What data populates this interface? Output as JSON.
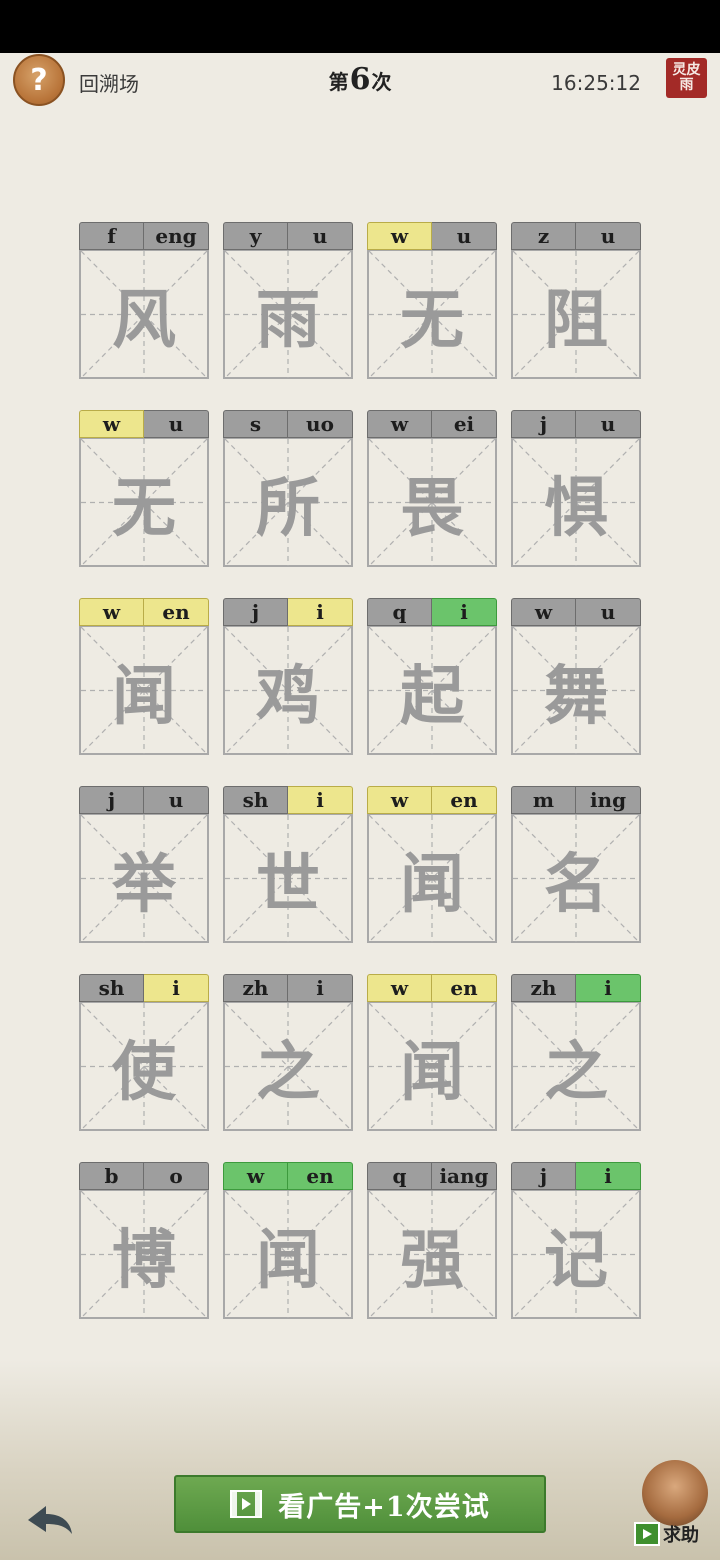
{
  "header": {
    "help_glyph": "?",
    "back_label": "回溯场",
    "attempt_prefix": "第",
    "attempt_number": "6",
    "attempt_suffix": "次",
    "clock": "16:25:12",
    "seal_text": "灵皮雨"
  },
  "colors": {
    "gray": "#9e9e9e",
    "yellow": "#ede68d",
    "green": "#6bc46b"
  },
  "rows": [
    [
      {
        "initial": "f",
        "final": "eng",
        "initial_state": "gray",
        "final_state": "gray",
        "char": "风"
      },
      {
        "initial": "y",
        "final": "u",
        "initial_state": "gray",
        "final_state": "gray",
        "char": "雨"
      },
      {
        "initial": "w",
        "final": "u",
        "initial_state": "yellow",
        "final_state": "gray",
        "char": "无"
      },
      {
        "initial": "z",
        "final": "u",
        "initial_state": "gray",
        "final_state": "gray",
        "char": "阻"
      }
    ],
    [
      {
        "initial": "w",
        "final": "u",
        "initial_state": "yellow",
        "final_state": "gray",
        "char": "无"
      },
      {
        "initial": "s",
        "final": "uo",
        "initial_state": "gray",
        "final_state": "gray",
        "char": "所"
      },
      {
        "initial": "w",
        "final": "ei",
        "initial_state": "gray",
        "final_state": "gray",
        "char": "畏"
      },
      {
        "initial": "j",
        "final": "u",
        "initial_state": "gray",
        "final_state": "gray",
        "char": "惧"
      }
    ],
    [
      {
        "initial": "w",
        "final": "en",
        "initial_state": "yellow",
        "final_state": "yellow",
        "char": "闻"
      },
      {
        "initial": "j",
        "final": "i",
        "initial_state": "gray",
        "final_state": "yellow",
        "char": "鸡"
      },
      {
        "initial": "q",
        "final": "i",
        "initial_state": "gray",
        "final_state": "green",
        "char": "起"
      },
      {
        "initial": "w",
        "final": "u",
        "initial_state": "gray",
        "final_state": "gray",
        "char": "舞"
      }
    ],
    [
      {
        "initial": "j",
        "final": "u",
        "initial_state": "gray",
        "final_state": "gray",
        "char": "举"
      },
      {
        "initial": "sh",
        "final": "i",
        "initial_state": "gray",
        "final_state": "yellow",
        "char": "世"
      },
      {
        "initial": "w",
        "final": "en",
        "initial_state": "yellow",
        "final_state": "yellow",
        "char": "闻"
      },
      {
        "initial": "m",
        "final": "ing",
        "initial_state": "gray",
        "final_state": "gray",
        "char": "名"
      }
    ],
    [
      {
        "initial": "sh",
        "final": "i",
        "initial_state": "gray",
        "final_state": "yellow",
        "char": "使"
      },
      {
        "initial": "zh",
        "final": "i",
        "initial_state": "gray",
        "final_state": "gray",
        "char": "之"
      },
      {
        "initial": "w",
        "final": "en",
        "initial_state": "yellow",
        "final_state": "yellow",
        "char": "闻"
      },
      {
        "initial": "zh",
        "final": "i",
        "initial_state": "gray",
        "final_state": "green",
        "char": "之"
      }
    ],
    [
      {
        "initial": "b",
        "final": "o",
        "initial_state": "gray",
        "final_state": "gray",
        "char": "博"
      },
      {
        "initial": "w",
        "final": "en",
        "initial_state": "green",
        "final_state": "green",
        "char": "闻"
      },
      {
        "initial": "q",
        "final": "iang",
        "initial_state": "gray",
        "final_state": "gray",
        "char": "强"
      },
      {
        "initial": "j",
        "final": "i",
        "initial_state": "gray",
        "final_state": "green",
        "char": "记"
      }
    ]
  ],
  "footer": {
    "ad_button_label": "看广告+1次尝试",
    "ad_icon": "video-icon",
    "back_icon": "back-arrow-icon",
    "helper_label": "求助",
    "helper_icon": "video-icon"
  }
}
